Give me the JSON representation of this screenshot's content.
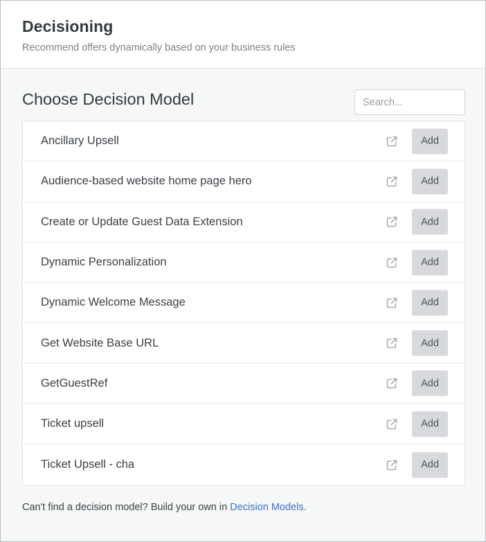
{
  "header": {
    "title": "Decisioning",
    "subtitle": "Recommend offers dynamically based on your business rules"
  },
  "section": {
    "title": "Choose Decision Model"
  },
  "search": {
    "placeholder": "Search...",
    "value": ""
  },
  "icons": {
    "row_action": "external-link-icon"
  },
  "colors": {
    "link": "#3c6ecf",
    "button_bg": "#d7d9dc"
  },
  "models": [
    {
      "name": "Ancillary Upsell",
      "action_label": "Add"
    },
    {
      "name": "Audience-based website home page hero",
      "action_label": "Add"
    },
    {
      "name": "Create or Update Guest Data Extension",
      "action_label": "Add"
    },
    {
      "name": "Dynamic Personalization",
      "action_label": "Add"
    },
    {
      "name": "Dynamic Welcome Message",
      "action_label": "Add"
    },
    {
      "name": "Get Website Base URL",
      "action_label": "Add"
    },
    {
      "name": "GetGuestRef",
      "action_label": "Add"
    },
    {
      "name": "Ticket upsell",
      "action_label": "Add"
    },
    {
      "name": "Ticket Upsell - cha",
      "action_label": "Add"
    }
  ],
  "footer": {
    "text": "Can't find a decision model? Build your own in ",
    "link_label": "Decision Models."
  }
}
